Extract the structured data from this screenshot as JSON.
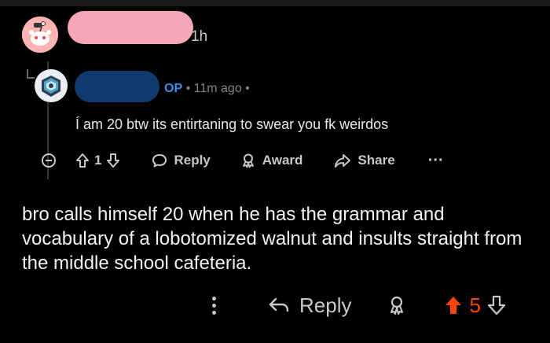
{
  "comment": {
    "time": "1h",
    "text": "bro calls himself 20 when he has the grammar and vocabulary of a lobotomized walnut and insults straight from the middle school cafeteria.",
    "actions": {
      "reply_label": "Reply",
      "score": "5"
    }
  },
  "parent_comment": {
    "op_badge": "OP",
    "separator": "•",
    "time": "11m ago",
    "text": "Í am 20 btw its entirtaning to swear you fk weirdos",
    "actions": {
      "vote_count": "1",
      "reply_label": "Reply",
      "award_label": "Award",
      "share_label": "Share",
      "more_label": "···"
    }
  },
  "colors": {
    "background": "#000000",
    "text": "#d7dadc",
    "op_blue": "#3d8ee8",
    "upvote_orange": "#ff4500",
    "username_redaction_pink": "#f7a6b5",
    "username_redaction_blue": "#0f3b6e"
  },
  "icons": [
    "reddit-snoo-avatar-icon",
    "op-avatar-icon",
    "collapse-icon",
    "upvote-icon",
    "downvote-icon",
    "reply-icon",
    "award-icon",
    "share-icon",
    "more-icon"
  ]
}
